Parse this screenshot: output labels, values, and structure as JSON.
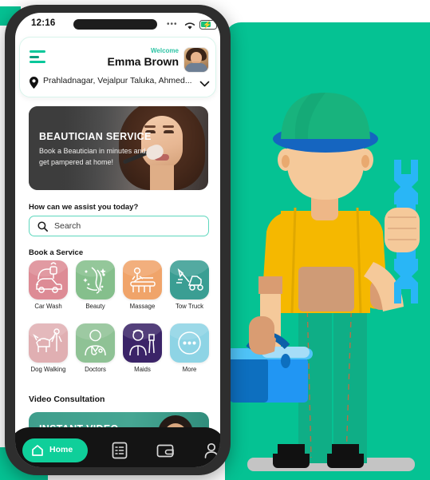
{
  "theme": {
    "brand_green": "#05c293",
    "accent_teal": "#0fcf9a",
    "nav_dark": "#141414",
    "frame_dark": "#2e2e2e"
  },
  "status_bar": {
    "time": "12:16",
    "signal_icon": "signal-dots-icon",
    "wifi_icon": "wifi-icon",
    "battery_icon": "battery-charging-icon"
  },
  "header": {
    "menu_icon": "hamburger-menu-icon",
    "welcome_label": "Welcome",
    "user_name": "Emma Brown",
    "avatar_icon": "user-avatar",
    "location_icon": "map-pin-icon",
    "location_text": "Prahladnagar, Vejalpur Taluka, Ahmed...",
    "location_chevron": "chevron-down-icon"
  },
  "banner": {
    "title": "BEAUTICIAN SERVICE",
    "subtitle": "Book a Beautician in minutes and get pampered at home!"
  },
  "search": {
    "section_title": "How can we assist you today?",
    "placeholder": "Search",
    "icon": "search-icon"
  },
  "services": {
    "section_title": "Book a Service",
    "items": [
      {
        "label": "Car Wash",
        "icon": "car-wash-icon",
        "color": "#dd8b95"
      },
      {
        "label": "Beauty",
        "icon": "beauty-face-icon",
        "color": "#85bf8c"
      },
      {
        "label": "Massage",
        "icon": "massage-icon",
        "color": "#f0a46a"
      },
      {
        "label": "Tow Truck",
        "icon": "tow-truck-icon",
        "color": "#3a9e93"
      },
      {
        "label": "Dog Walking",
        "icon": "dog-walking-icon",
        "color": "#e0afb2"
      },
      {
        "label": "Doctors",
        "icon": "doctor-icon",
        "color": "#8fc295"
      },
      {
        "label": "Maids",
        "icon": "maid-icon",
        "color": "#3b2468"
      },
      {
        "label": "More",
        "icon": "more-dots-icon",
        "color": "#8ed4e5"
      }
    ]
  },
  "video_consultation": {
    "section_title": "Video Consultation",
    "card_title": "INSTANT VIDEO"
  },
  "bottom_nav": {
    "items": [
      {
        "label": "Home",
        "icon": "home-icon",
        "active": true
      },
      {
        "label": "",
        "icon": "orders-list-icon",
        "active": false
      },
      {
        "label": "",
        "icon": "wallet-icon",
        "active": false
      },
      {
        "label": "",
        "icon": "profile-person-icon",
        "active": false
      }
    ]
  },
  "illustration": {
    "name": "handyman-worker-illustration",
    "cap_color": "#18b37d",
    "cap_brim_color": "#1565c0",
    "shirt_color": "#f5b800",
    "skin_color": "#f5c99a",
    "wrench_color": "#29b6f6",
    "toolbox_color": "#2196f3",
    "boots_color": "#111111",
    "floor_color": "#c4c4c4"
  }
}
